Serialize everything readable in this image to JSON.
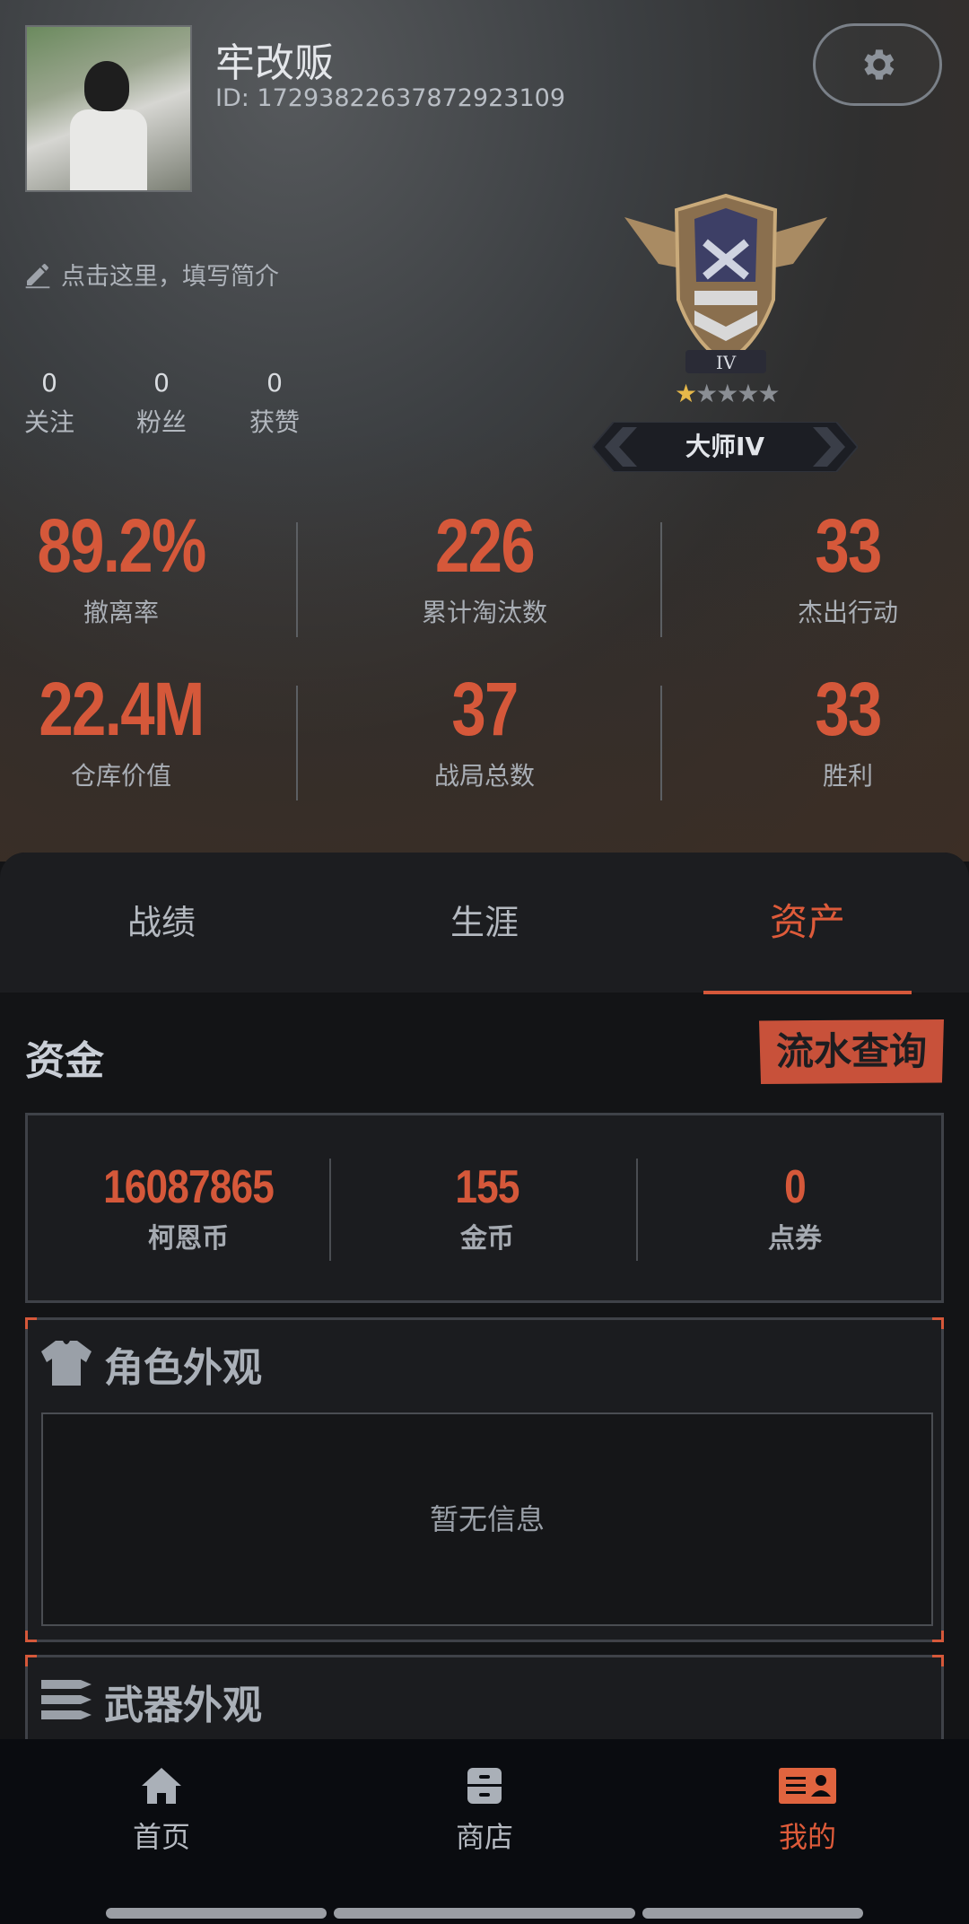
{
  "profile": {
    "username": "牢改贩",
    "id_text": "ID: 1729382263787292310​9",
    "bio_placeholder": "点击这里，填写简介"
  },
  "social": [
    {
      "count": "0",
      "label": "关注"
    },
    {
      "count": "0",
      "label": "粉丝"
    },
    {
      "count": "0",
      "label": "获赞"
    }
  ],
  "rank": {
    "badge_numeral": "IV",
    "title": "大师IV",
    "stars_filled": 1,
    "stars_total": 5
  },
  "stats": [
    {
      "value": "89.2%",
      "label": "撤离率"
    },
    {
      "value": "226",
      "label": "累计淘汰数"
    },
    {
      "value": "33",
      "label": "杰出行动"
    },
    {
      "value": "22.4M",
      "label": "仓库价值"
    },
    {
      "value": "37",
      "label": "战局总数"
    },
    {
      "value": "33",
      "label": "胜利"
    }
  ],
  "tabs": [
    {
      "label": "战绩"
    },
    {
      "label": "生涯"
    },
    {
      "label": "资产"
    }
  ],
  "funds": {
    "title": "资金",
    "flow_button": "流水查询",
    "items": [
      {
        "value": "16087865",
        "label": "柯恩币"
      },
      {
        "value": "155",
        "label": "金币"
      },
      {
        "value": "0",
        "label": "点券"
      }
    ]
  },
  "appearance": {
    "title": "角色外观",
    "empty_text": "暂无信息"
  },
  "weapon_appearance": {
    "title": "武器外观"
  },
  "nav": [
    {
      "label": "首页",
      "icon": "home-icon"
    },
    {
      "label": "商店",
      "icon": "shop-icon"
    },
    {
      "label": "我的",
      "icon": "profile-card-icon"
    }
  ],
  "colors": {
    "accent": "#d5583a",
    "background": "#131416",
    "navbar": "#0a0c10"
  }
}
